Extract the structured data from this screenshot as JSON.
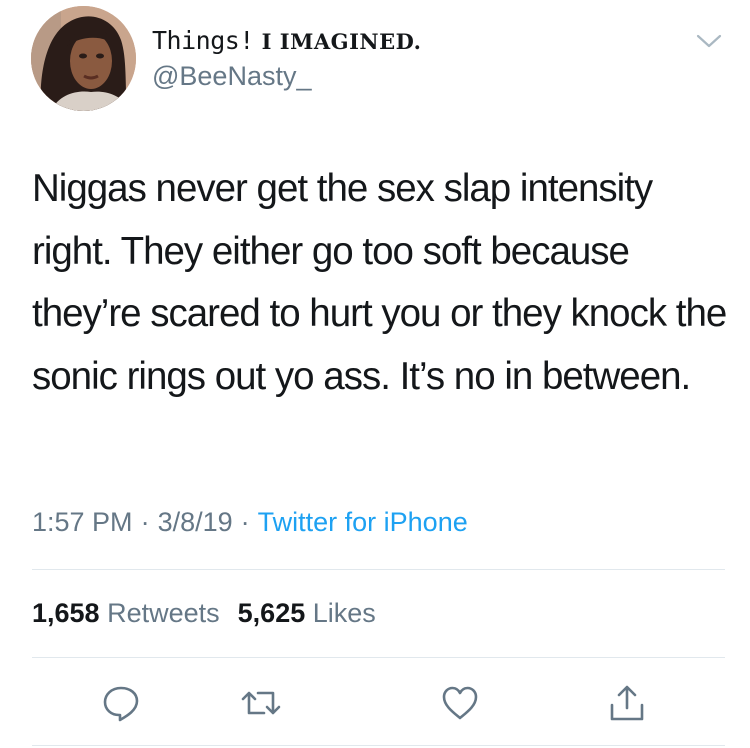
{
  "tweet": {
    "display_name_part1": "Things!",
    "display_name_part2": " I IMAGINED.",
    "handle": "@BeeNasty_",
    "text": "Niggas never get the sex slap intensity right. They either go too soft because they’re scared to hurt you or they knock the sonic rings out yo ass. It’s no in between.",
    "time": "1:57 PM",
    "separator": "·",
    "date": "3/8/19",
    "source": "Twitter for iPhone",
    "retweets_count": "1,658",
    "retweets_label": "Retweets",
    "likes_count": "5,625",
    "likes_label": "Likes"
  },
  "icons": {
    "menu": "chevron-down-icon",
    "reply": "reply-icon",
    "retweet": "retweet-icon",
    "like": "heart-icon",
    "share": "share-icon"
  },
  "colors": {
    "text_primary": "#14171a",
    "text_secondary": "#657786",
    "link": "#1da1f2",
    "divider": "#e1e8ed"
  }
}
